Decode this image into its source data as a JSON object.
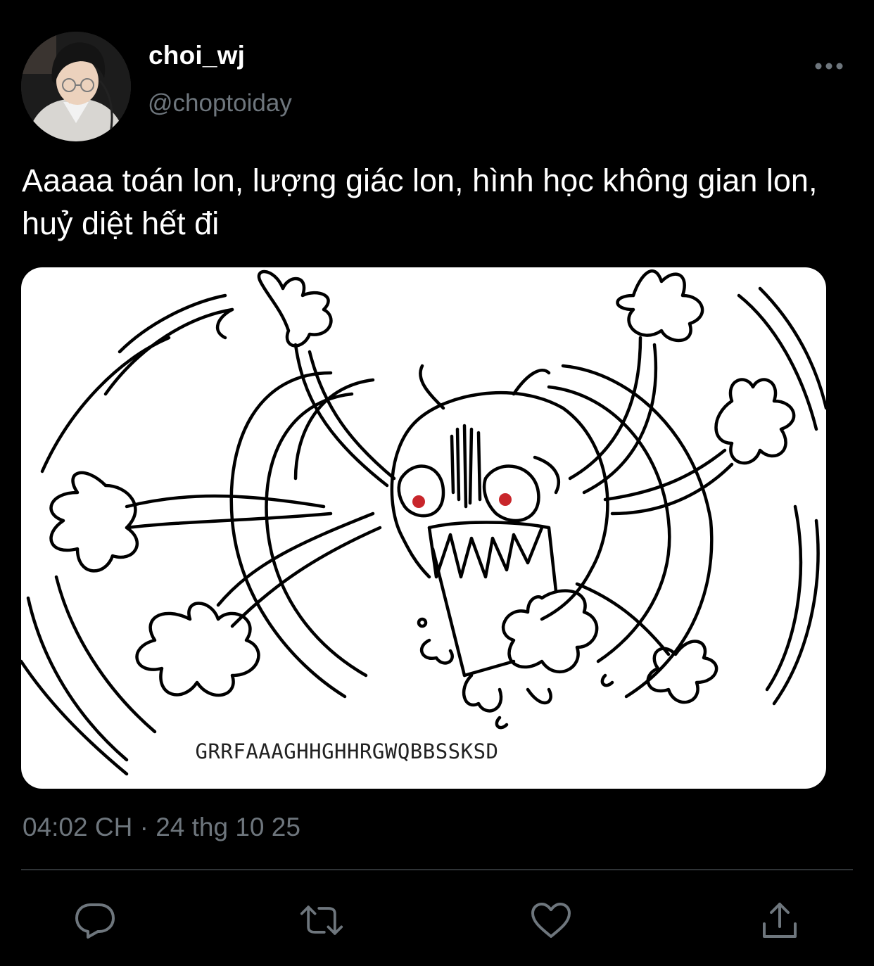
{
  "author": {
    "display_name": "choi_wj",
    "handle": "@choptoiday"
  },
  "tweet": {
    "text": "Aaaaa toán lon, lượng giác lon, hình học không gian lon, huỷ diệt hết đi",
    "timestamp": "04:02 CH · 24 thg 10 25"
  },
  "media": {
    "caption_text": "GRRFAAAGHHGHHRGWQBBSSKSD"
  },
  "icons": {
    "more": "more-horizontal-icon",
    "reply": "reply-icon",
    "retweet": "retweet-icon",
    "like": "heart-icon",
    "share": "share-icon"
  },
  "colors": {
    "background": "#000000",
    "primary_text": "#ffffff",
    "secondary_text": "#6e767d",
    "icon": "#6e767d",
    "divider": "#2f3336"
  }
}
